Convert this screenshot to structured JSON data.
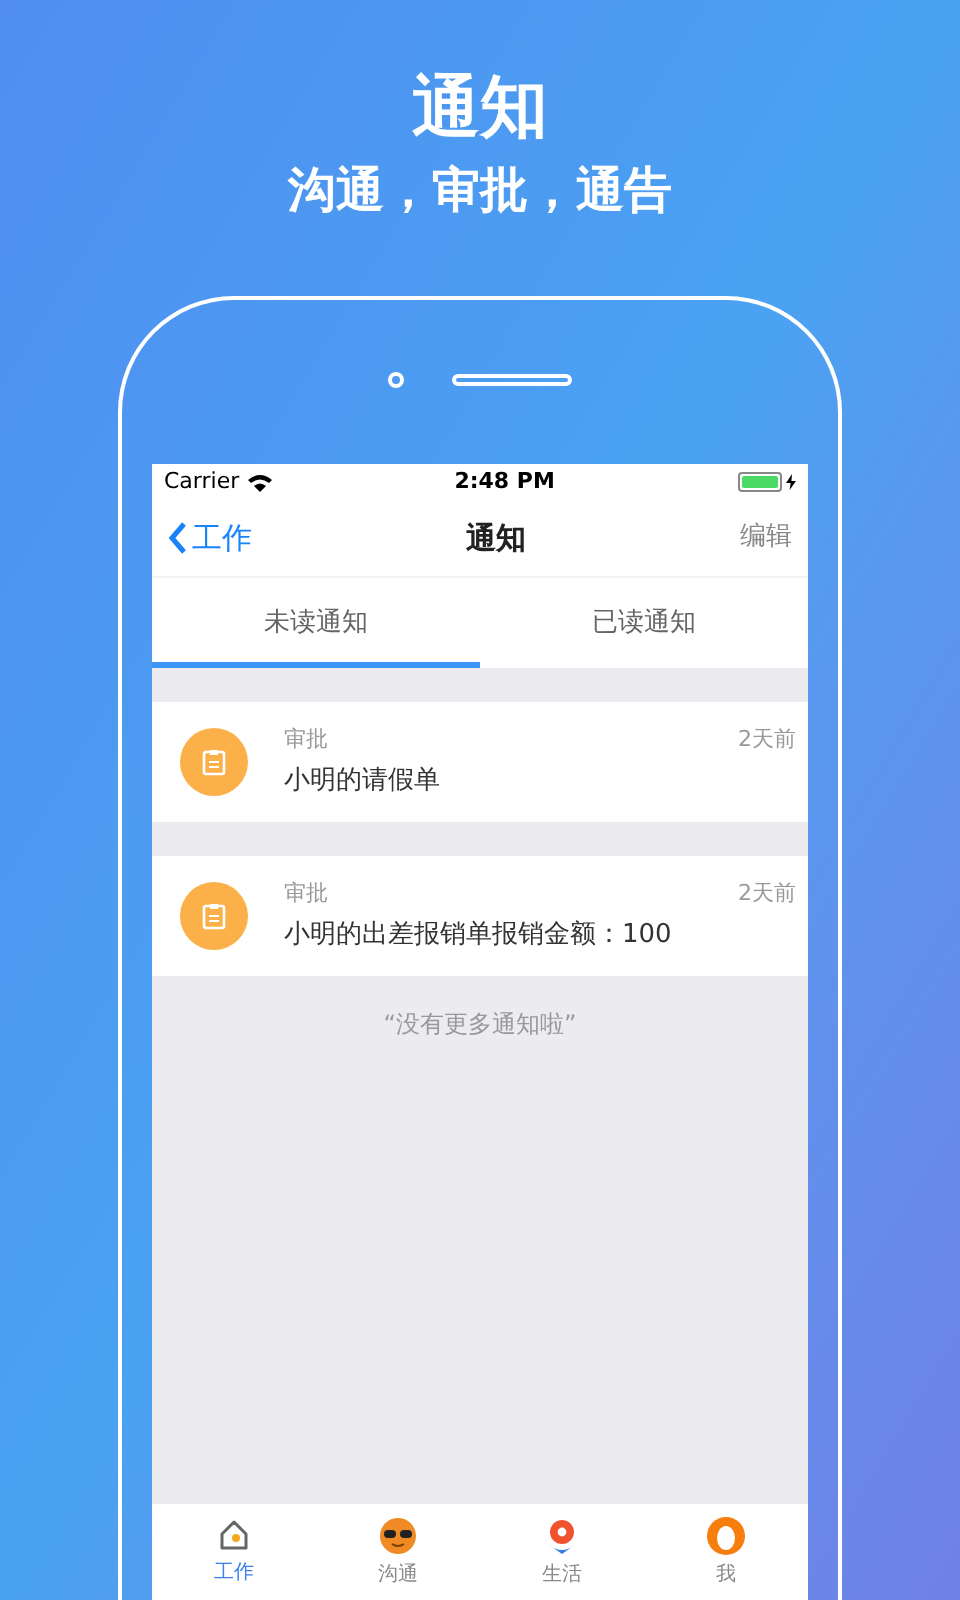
{
  "headline": "通知",
  "subheadline": "沟通，审批，通告",
  "status_bar": {
    "carrier": "Carrier",
    "time": "2:48 PM"
  },
  "nav": {
    "back": "工作",
    "title": "通知",
    "action": "编辑"
  },
  "tabs": [
    {
      "label": "未读通知",
      "selected": true
    },
    {
      "label": "已读通知",
      "selected": false
    }
  ],
  "notifications": [
    {
      "category": "审批",
      "text": "小明的请假单",
      "time": "2天前"
    },
    {
      "category": "审批",
      "text": "小明的出差报销单报销金额：100",
      "time": "2天前"
    }
  ],
  "end_note": "“没有更多通知啦”",
  "bottom_nav": [
    {
      "kind": "work",
      "label": "工作",
      "selected": true
    },
    {
      "kind": "chat",
      "label": "沟通",
      "selected": false
    },
    {
      "kind": "life",
      "label": "生活",
      "selected": false
    },
    {
      "kind": "me",
      "label": "我",
      "selected": false
    }
  ]
}
